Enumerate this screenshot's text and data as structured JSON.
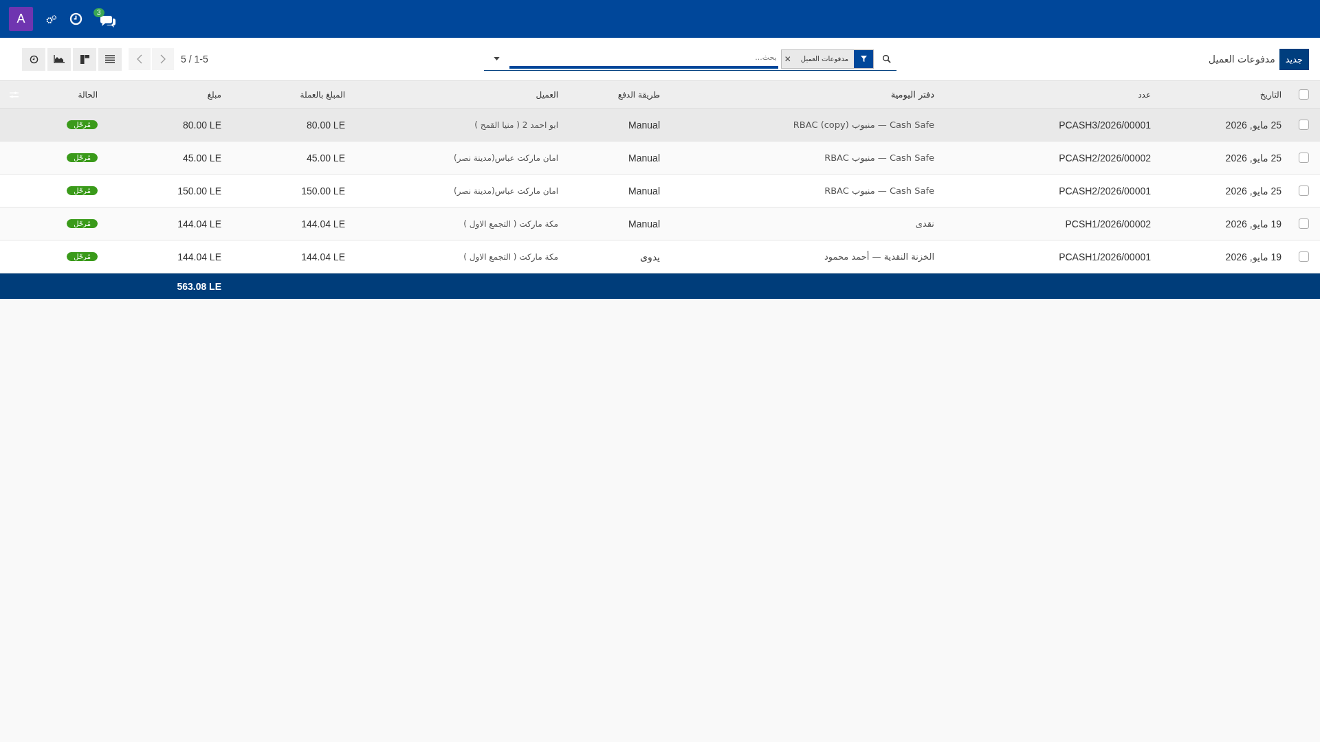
{
  "topbar": {
    "avatar": "A",
    "chat_badge": "3"
  },
  "control_panel": {
    "breadcrumb": "مدفوعات العميل",
    "new_button": "جديد",
    "search": {
      "placeholder": "بحث...",
      "facet": "مدفوعات العميل",
      "facet_remove": "✕"
    },
    "pager": "5 / 1-5"
  },
  "views": [
    {
      "kind": "activity",
      "selected": false
    },
    {
      "kind": "graph",
      "selected": false
    },
    {
      "kind": "kanban",
      "selected": false
    },
    {
      "kind": "list",
      "selected": false
    }
  ],
  "table": {
    "select_all": false,
    "columns": [
      "التاريخ",
      "عدد",
      "دفتر اليومية",
      "طريقة الدفع",
      "العميل",
      "المبلغ بالعملة",
      "مبلغ",
      "الحالة"
    ],
    "rows": [
      {
        "checked": false,
        "highlighted": true,
        "cells": [
          "25 مايو, 2026",
          "PCASH3/2026/00001",
          "Cash Safe — منبوب RBAC (copy)",
          "Manual",
          "ابو احمد 2 ( منيا القمح )",
          "80.00 LE",
          "80.00 LE"
        ],
        "status": "مُرحّل"
      },
      {
        "checked": false,
        "highlighted": false,
        "cells": [
          "25 مايو, 2026",
          "PCASH2/2026/00002",
          "Cash Safe — منبوب RBAC",
          "Manual",
          "امان ماركت عباس(مدينة نصر)",
          "45.00 LE",
          "45.00 LE"
        ],
        "status": "مُرحّل"
      },
      {
        "checked": false,
        "highlighted": false,
        "cells": [
          "25 مايو, 2026",
          "PCASH2/2026/00001",
          "Cash Safe — منبوب RBAC",
          "Manual",
          "امان ماركت عباس(مدينة نصر)",
          "150.00 LE",
          "150.00 LE"
        ],
        "status": "مُرحّل"
      },
      {
        "checked": false,
        "highlighted": false,
        "cells": [
          "19 مايو, 2026",
          "PCSH1/2026/00002",
          "نقدى",
          "Manual",
          "مكة ماركت ( التجمع الاول )",
          "144.04 LE",
          "144.04 LE"
        ],
        "status": "مُرحّل"
      },
      {
        "checked": false,
        "highlighted": false,
        "cells": [
          "19 مايو, 2026",
          "PCASH1/2026/00001",
          "الخزنة النقدية — أحمد محمود",
          "يدوى",
          "مكة ماركت ( التجمع الاول )",
          "144.04 LE",
          "144.04 LE"
        ],
        "status": "مُرحّل"
      }
    ],
    "total": "563.08 LE"
  }
}
